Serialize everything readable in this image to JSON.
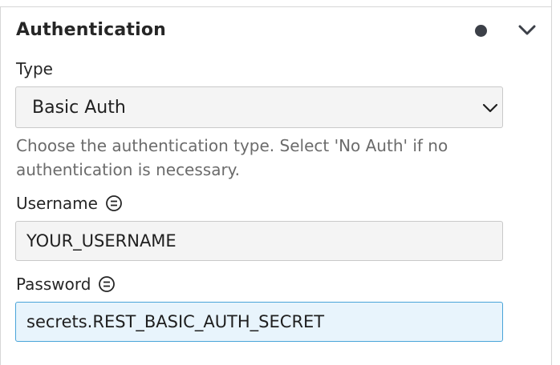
{
  "section": {
    "title": "Authentication",
    "status_icon": "filled-dot-icon",
    "toggle_icon": "chevron-down-icon"
  },
  "type_field": {
    "label": "Type",
    "selected": "Basic Auth",
    "help": "Choose the authentication type. Select 'No Auth' if no authentication is necessary."
  },
  "username_field": {
    "label": "Username",
    "value": "YOUR_USERNAME",
    "info_icon": "equals-circle-icon"
  },
  "password_field": {
    "label": "Password",
    "value": "secrets.REST_BASIC_AUTH_SECRET",
    "info_icon": "equals-circle-icon"
  },
  "colors": {
    "text": "#262626",
    "muted": "#6b6b6b",
    "input_bg": "#f4f4f4",
    "focus_bg": "#e8f4fc",
    "focus_border": "#49a4d9"
  }
}
